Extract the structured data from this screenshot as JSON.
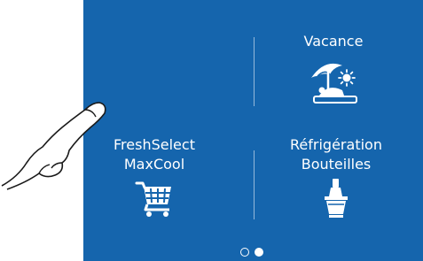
{
  "tiles": {
    "vacation": {
      "label": "Vacance",
      "icon": "beach-umbrella-icon"
    },
    "fresh_select": {
      "line1": "FreshSelect",
      "line2": "MaxCool",
      "icon": "shopping-cart-icon"
    },
    "bottle_cooling": {
      "line1": "Réfrigération",
      "line2": "Bouteilles",
      "icon": "bottle-bucket-icon"
    }
  },
  "pager": {
    "page_count": 2,
    "active_index": 1
  },
  "decorations": {
    "gesture": "pointing-hand-icon"
  },
  "colors": {
    "panel_background": "#1565ad",
    "foreground": "#ffffff"
  }
}
